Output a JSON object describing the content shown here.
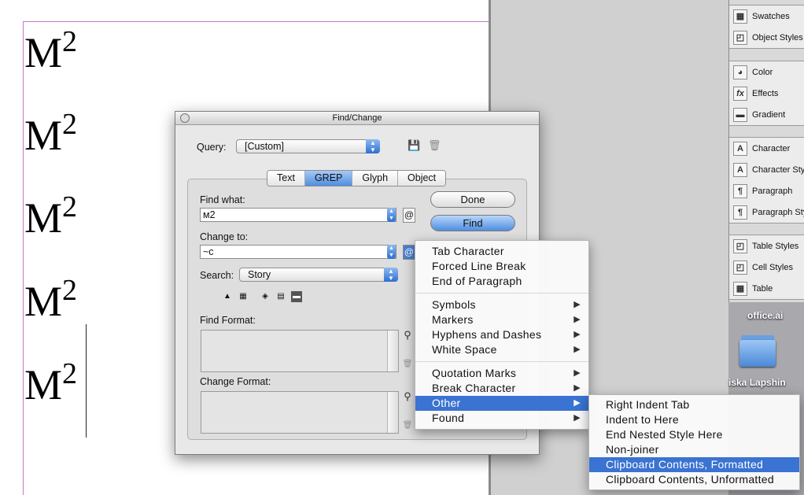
{
  "document": {
    "lines": [
      {
        "base": "M",
        "sup": "2"
      },
      {
        "base": "M",
        "sup": "2"
      },
      {
        "base": "M",
        "sup": "2"
      },
      {
        "base": "M",
        "sup": "2"
      },
      {
        "base": "M",
        "sup": "2"
      }
    ]
  },
  "panel": {
    "groups": [
      {
        "items": [
          {
            "label": "Swatches",
            "icon": "▦"
          },
          {
            "label": "Object Styles",
            "icon": "◰"
          }
        ]
      },
      {
        "items": [
          {
            "label": "Color",
            "icon": "◕"
          },
          {
            "label": "Effects",
            "icon": "fx"
          },
          {
            "label": "Gradient",
            "icon": "▬"
          }
        ]
      },
      {
        "items": [
          {
            "label": "Character",
            "icon": "A"
          },
          {
            "label": "Character Sty",
            "icon": "A"
          },
          {
            "label": "Paragraph",
            "icon": "¶"
          },
          {
            "label": "Paragraph Sty",
            "icon": "¶"
          }
        ]
      },
      {
        "items": [
          {
            "label": "Table Styles",
            "icon": "◰"
          },
          {
            "label": "Cell Styles",
            "icon": "◰"
          },
          {
            "label": "Table",
            "icon": "▦"
          }
        ]
      }
    ]
  },
  "desktop": {
    "label1": "office.ai",
    "label2": "iska Lapshin"
  },
  "dialog": {
    "title": "Find/Change",
    "query_label": "Query:",
    "query_value": "[Custom]",
    "tabs": [
      "Text",
      "GREP",
      "Glyph",
      "Object"
    ],
    "find_what_label": "Find what:",
    "find_what_value": "м2",
    "change_to_label": "Change to:",
    "change_to_value": "~c",
    "search_label": "Search:",
    "search_value": "Story",
    "find_format_label": "Find Format:",
    "change_format_label": "Change Format:",
    "done_label": "Done",
    "find_label": "Find",
    "at_symbol": "@"
  },
  "special_menu": {
    "group1": [
      {
        "label": "Tab Character"
      },
      {
        "label": "Forced Line Break"
      },
      {
        "label": "End of Paragraph"
      }
    ],
    "group2": [
      {
        "label": "Symbols"
      },
      {
        "label": "Markers"
      },
      {
        "label": "Hyphens and Dashes"
      },
      {
        "label": "White Space"
      }
    ],
    "group3": [
      {
        "label": "Quotation Marks"
      },
      {
        "label": "Break Character"
      },
      {
        "label": "Other"
      },
      {
        "label": "Found"
      }
    ],
    "submenu_arrow": "▶"
  },
  "other_submenu": {
    "items": [
      {
        "label": "Right Indent Tab"
      },
      {
        "label": "Indent to Here"
      },
      {
        "label": "End Nested Style Here"
      },
      {
        "label": "Non-joiner"
      },
      {
        "label": "Clipboard Contents, Formatted"
      },
      {
        "label": "Clipboard Contents, Unformatted"
      }
    ]
  },
  "colors": {
    "highlight": "#3a73d1",
    "margin_guide": "#c678c6"
  }
}
